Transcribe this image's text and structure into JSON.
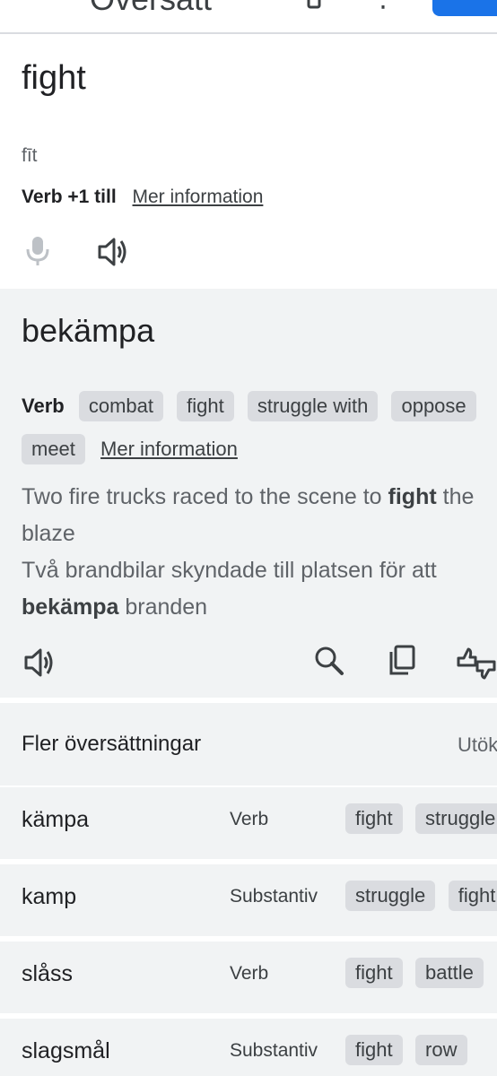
{
  "appbar": {
    "title": "Översätt",
    "more_label": "⋮"
  },
  "source": {
    "word": "fight",
    "phonetic": "fīt",
    "pos": "Verb",
    "extra": "+1 till",
    "more_info": "Mer information"
  },
  "translation": {
    "word": "bekämpa",
    "pos": "Verb",
    "synonyms": [
      "combat",
      "fight",
      "struggle with",
      "oppose",
      "meet"
    ],
    "more_info": "Mer information",
    "example_en_before": "Two fire trucks raced to the scene to ",
    "example_en_bold": "fight",
    "example_en_after": " the blaze",
    "example_sv_before": "Två brandbilar skyndade till platsen för att ",
    "example_sv_bold": "bekämpa",
    "example_sv_after": " branden"
  },
  "more_translations": {
    "title": "Fler översättningar",
    "expand_label": "Utöka",
    "rows": [
      {
        "word": "kämpa",
        "pos": "Verb",
        "chips": [
          "fight",
          "struggle"
        ]
      },
      {
        "word": "kamp",
        "pos": "Substantiv",
        "chips": [
          "struggle",
          "fight"
        ]
      },
      {
        "word": "slåss",
        "pos": "Verb",
        "chips": [
          "fight",
          "battle"
        ]
      },
      {
        "word": "slagsmål",
        "pos": "Substantiv",
        "chips": [
          "fight",
          "row"
        ]
      }
    ]
  },
  "colors": {
    "accent": "#1a73e8",
    "panel": "#f1f3f4",
    "chip": "#dadce0",
    "text": "#202124",
    "muted": "#5f6368"
  },
  "icons": {
    "mic": "microphone-icon",
    "speaker": "speaker-icon",
    "search": "search-icon",
    "copy": "copy-icon",
    "feedback": "feedback-icon"
  }
}
